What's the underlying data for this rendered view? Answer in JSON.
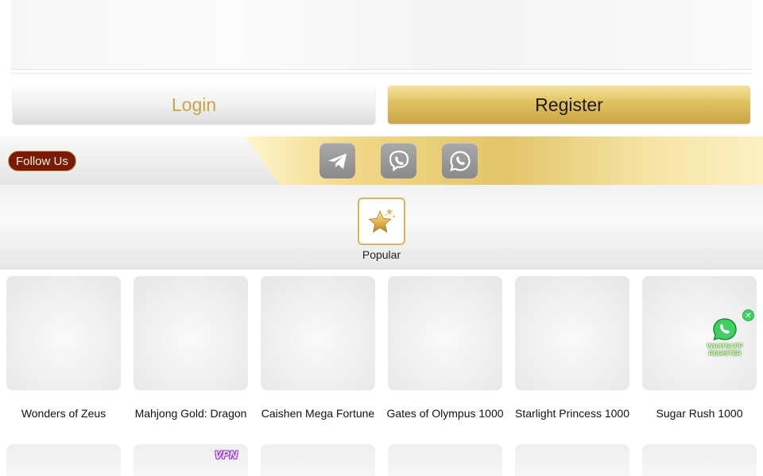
{
  "auth": {
    "login_label": "Login",
    "register_label": "Register"
  },
  "follow": {
    "label": "Follow Us",
    "socials": [
      {
        "name": "telegram-icon"
      },
      {
        "name": "viber-icon"
      },
      {
        "name": "whatsapp-icon"
      }
    ]
  },
  "categories": {
    "active": {
      "label": "Popular",
      "icon": "star-icon"
    }
  },
  "games": [
    {
      "name": "Wonders of Zeus"
    },
    {
      "name": "Mahjong Gold: Dragon"
    },
    {
      "name": "Caishen Mega Fortune"
    },
    {
      "name": "Gates of Olympus 1000"
    },
    {
      "name": "Starlight Princess 1000"
    },
    {
      "name": "Sugar Rush 1000"
    }
  ],
  "floating": {
    "whatsapp_label_line1": "WHATSAPP",
    "whatsapp_label_line2": "REGISTER",
    "close_symbol": "✕",
    "vpn_label": "VPN"
  },
  "colors": {
    "gold": "#d6b45c",
    "login_text": "#c9a24a",
    "follow_pill": "#7a1a0c",
    "whatsapp_green": "#3fcf63"
  }
}
